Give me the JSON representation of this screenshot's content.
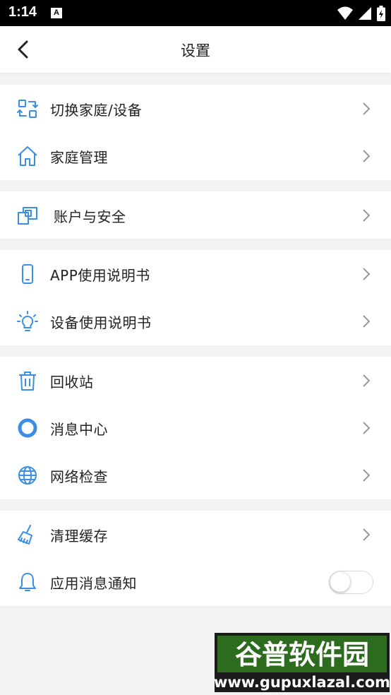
{
  "status_bar": {
    "time": "1:14",
    "notification_badge": "A"
  },
  "header": {
    "title": "设置",
    "back_icon": "chevron-left-icon"
  },
  "groups": [
    {
      "items": [
        {
          "label": "切换家庭/设备",
          "icon": "switch-home-device-icon"
        },
        {
          "label": "家庭管理",
          "icon": "home-icon"
        }
      ]
    },
    {
      "items": [
        {
          "label": "账户与安全",
          "icon": "account-security-icon"
        }
      ]
    },
    {
      "items": [
        {
          "label": "APP使用说明书",
          "icon": "phone-icon"
        },
        {
          "label": "设备使用说明书",
          "icon": "lightbulb-icon"
        }
      ]
    },
    {
      "items": [
        {
          "label": "回收站",
          "icon": "trash-icon"
        },
        {
          "label": "消息中心",
          "icon": "message-ring-icon"
        },
        {
          "label": "网络检查",
          "icon": "globe-icon"
        }
      ]
    },
    {
      "items": [
        {
          "label": "清理缓存",
          "icon": "broom-icon"
        },
        {
          "label": "应用消息通知",
          "icon": "bell-icon",
          "toggle": false
        }
      ]
    }
  ],
  "colors": {
    "accent": "#3a8ee6",
    "background": "#f3f3f3"
  },
  "watermark": {
    "name": "谷普软件园",
    "url": "www.gupuxlazal.com"
  }
}
